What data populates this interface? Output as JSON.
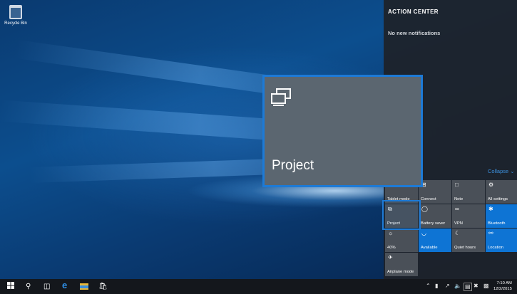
{
  "desktop": {
    "recycle_bin_label": "Recycle Bin"
  },
  "action_center": {
    "title": "ACTION CENTER",
    "no_notifications": "No new notifications",
    "collapse_label": "Collapse",
    "tiles": [
      {
        "label": "Tablet mode",
        "icon": "tablet-icon",
        "active": false
      },
      {
        "label": "Connect",
        "icon": "connect-icon",
        "active": false
      },
      {
        "label": "Note",
        "icon": "note-icon",
        "active": false
      },
      {
        "label": "All settings",
        "icon": "gear-icon",
        "active": false
      },
      {
        "label": "Project",
        "icon": "project-icon",
        "active": false
      },
      {
        "label": "Battery saver",
        "icon": "battery-icon",
        "active": false
      },
      {
        "label": "VPN",
        "icon": "vpn-icon",
        "active": false
      },
      {
        "label": "Bluetooth",
        "icon": "bluetooth-icon",
        "active": true
      },
      {
        "label": "40%",
        "icon": "brightness-icon",
        "active": false
      },
      {
        "label": "Available",
        "icon": "wifi-icon",
        "active": true
      },
      {
        "label": "Quiet hours",
        "icon": "moon-icon",
        "active": false
      },
      {
        "label": "Location",
        "icon": "location-icon",
        "active": true
      },
      {
        "label": "Airplane mode",
        "icon": "airplane-icon",
        "active": false
      }
    ]
  },
  "popup": {
    "title": "Project",
    "icon": "project-icon"
  },
  "taskbar": {
    "icons": [
      "windows-start-icon",
      "search-icon",
      "task-view-icon",
      "edge-icon",
      "file-explorer-icon",
      "store-icon"
    ],
    "clock_time": "7:10 AM",
    "clock_date": "12/2/2015"
  },
  "colors": {
    "accent": "#1d7ad6",
    "tile": "#4a5058",
    "tile_active": "#0e74d4",
    "action_center_bg": "#1e2228"
  }
}
